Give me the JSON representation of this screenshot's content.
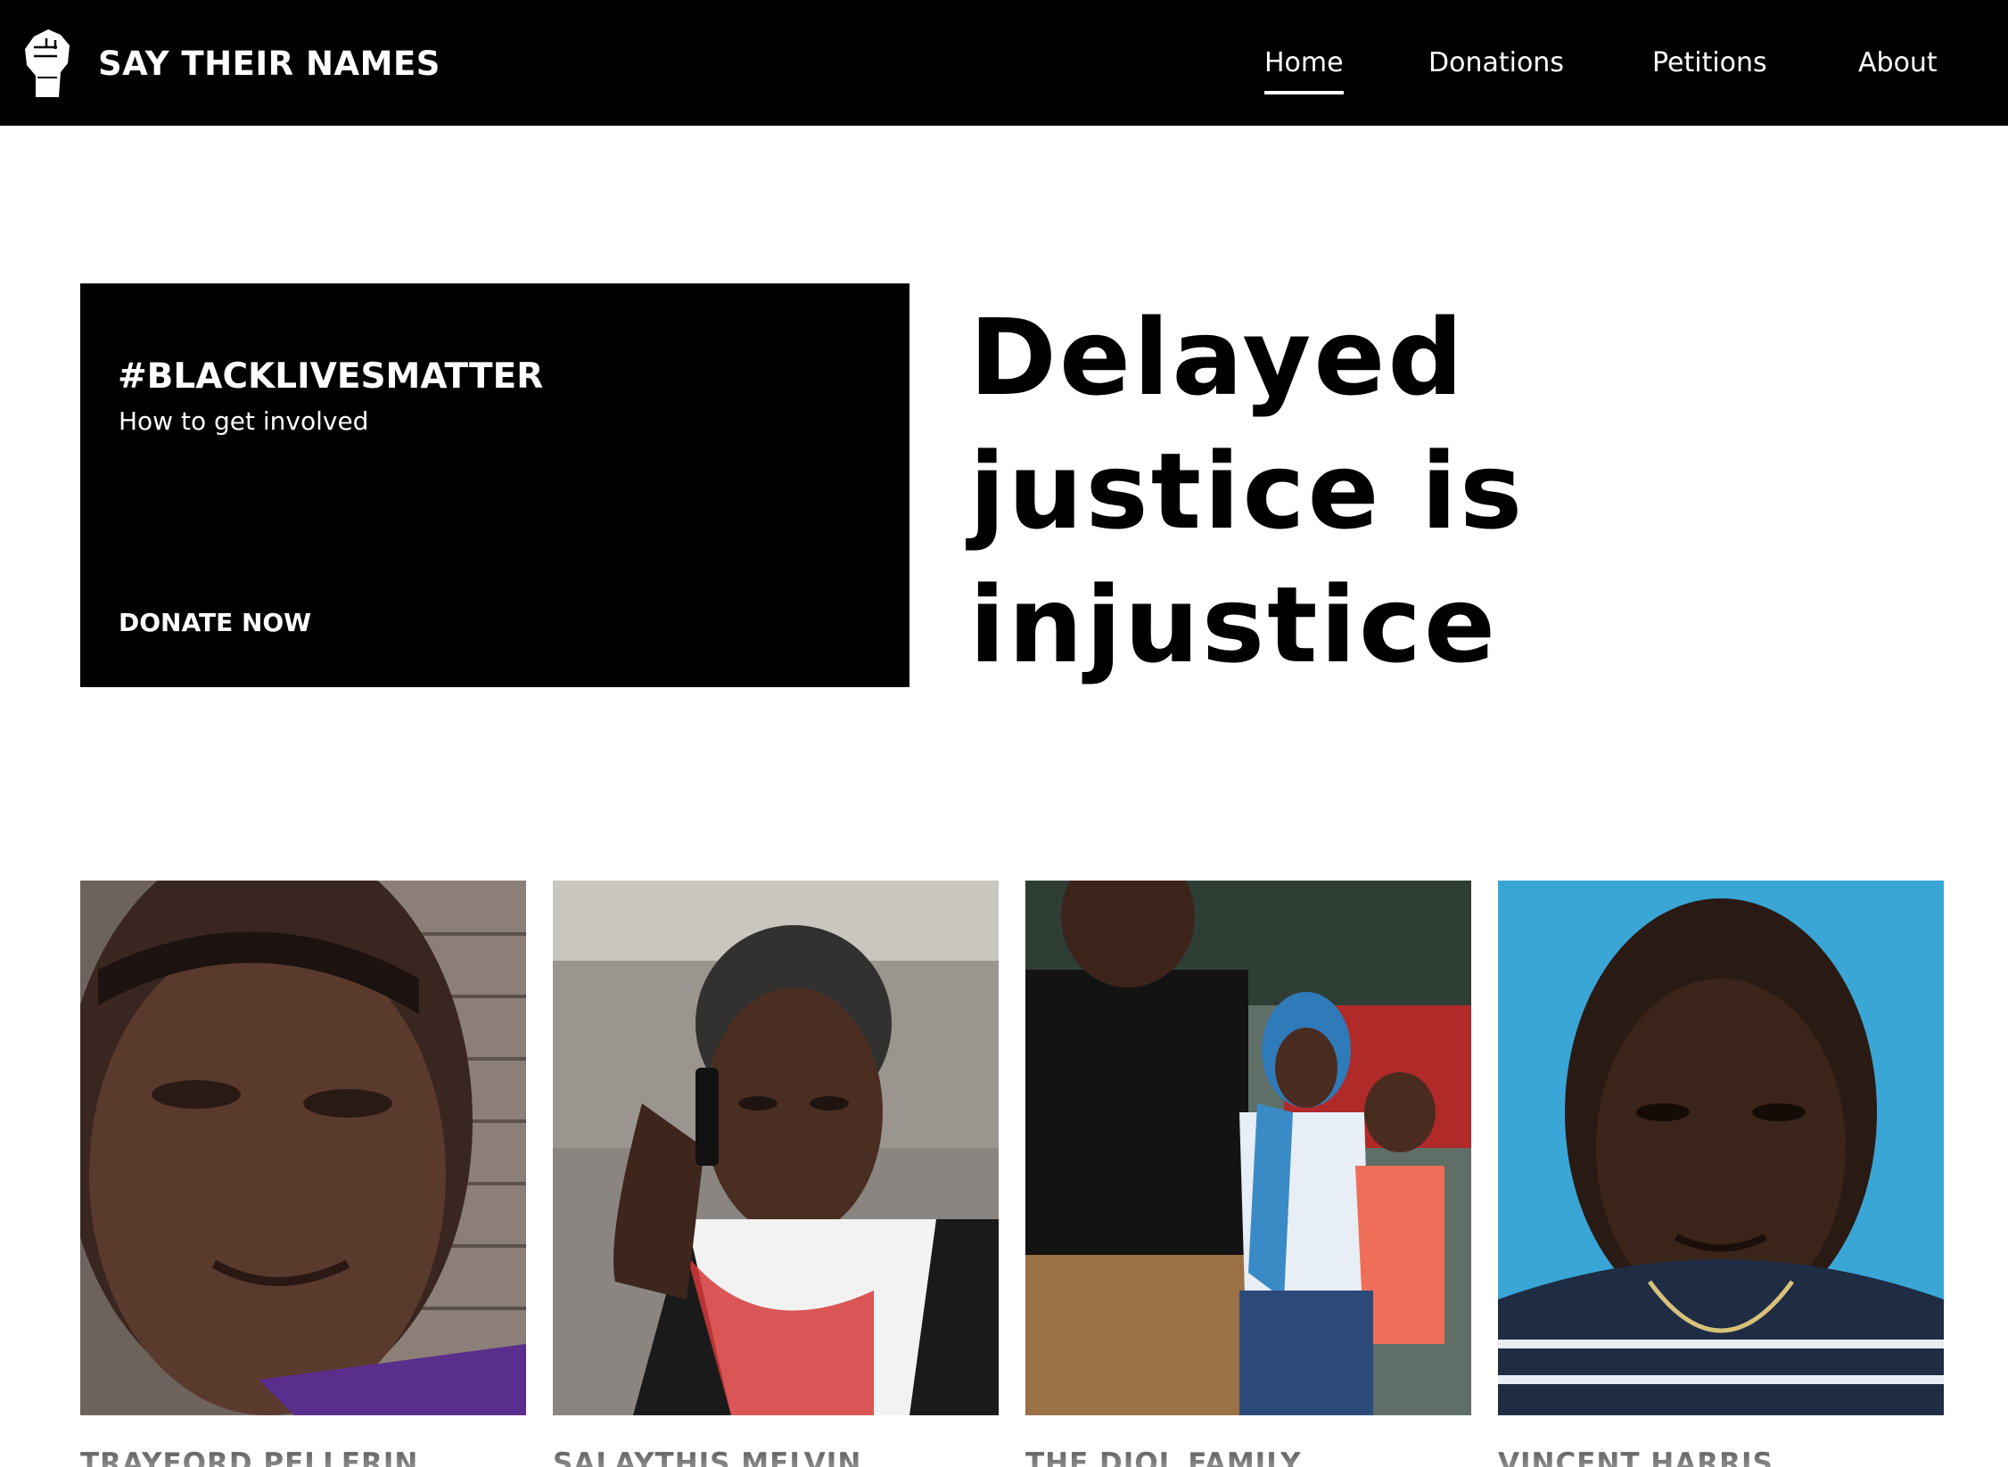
{
  "brand": {
    "name": "SAY THEIR NAMES",
    "logo_icon": "raised-fist-icon"
  },
  "nav": {
    "items": [
      {
        "label": "Home",
        "active": true
      },
      {
        "label": "Donations",
        "active": false
      },
      {
        "label": "Petitions",
        "active": false
      },
      {
        "label": "About",
        "active": false
      }
    ]
  },
  "promo": {
    "title": "#BLACKLIVESMATTER",
    "subtitle": "How to get involved",
    "cta": "DONATE NOW"
  },
  "headline": {
    "lines": [
      "Delayed",
      "justice is",
      "injustice"
    ]
  },
  "people": [
    {
      "name": "TRAYFORD PELLERIN"
    },
    {
      "name": "SALAYTHIS MELVIN"
    },
    {
      "name": "THE DIOL FAMILY"
    },
    {
      "name": "VINCENT HARRIS"
    }
  ],
  "colors": {
    "nav_bg": "#000000",
    "nav_text": "#ffffff",
    "promo_bg": "#000000",
    "page_bg": "#ffffff"
  }
}
